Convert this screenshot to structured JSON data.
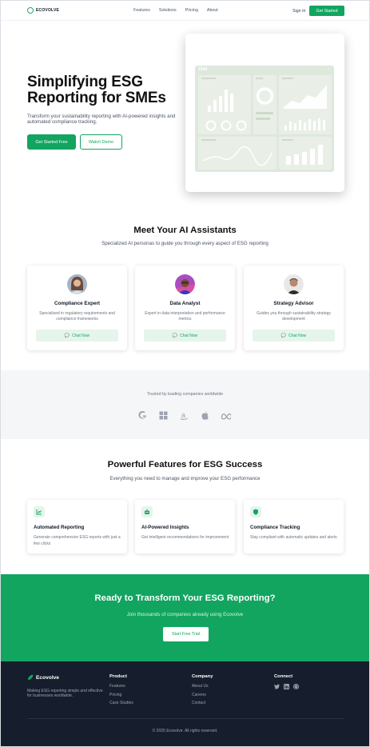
{
  "nav": {
    "logo_text": "ECOVOLVE",
    "links": [
      "Features",
      "Solutions",
      "Pricing",
      "About"
    ],
    "signin_label": "Sign In",
    "get_started_label": "Get Started"
  },
  "hero": {
    "title": "Simplifying ESG Reporting for SMEs",
    "subtitle": "Transform your sustainability reporting with AI-powered insights and automated compliance tracking.",
    "primary_cta": "Get Started Free",
    "secondary_cta": "Watch Demo",
    "dashboard_value": "1540"
  },
  "assistants": {
    "title": "Meet Your AI Assistants",
    "subtitle": "Specialized AI personas to guide you through every aspect of ESG reporting",
    "items": [
      {
        "name": "Compliance Expert",
        "desc": "Specialized in regulatory requirements and compliance frameworks",
        "cta": "Chat Now"
      },
      {
        "name": "Data Analyst",
        "desc": "Expert in data interpretation and performance metrics",
        "cta": "Chat Now"
      },
      {
        "name": "Strategy Advisor",
        "desc": "Guides you through sustainability strategy development",
        "cta": "Chat Now"
      }
    ]
  },
  "trusted": {
    "title": "Trusted by leading companies worldwide",
    "brands": [
      "google-logo-icon",
      "windows-logo-icon",
      "amazon-logo-icon",
      "apple-logo-icon",
      "meta-logo-icon"
    ]
  },
  "features": {
    "title": "Powerful Features for ESG Success",
    "subtitle": "Everything you need to manage and improve your ESG performance",
    "items": [
      {
        "title": "Automated Reporting",
        "desc": "Generate comprehensive ESG reports with just a few clicks",
        "icon": "chart-icon"
      },
      {
        "title": "AI-Powered Insights",
        "desc": "Get intelligent recommendations for improvement",
        "icon": "robot-icon"
      },
      {
        "title": "Compliance Tracking",
        "desc": "Stay compliant with automatic updates and alerts",
        "icon": "shield-icon"
      }
    ]
  },
  "cta": {
    "title": "Ready to Transform Your ESG Reporting?",
    "subtitle": "Join thousands of companies already using Ecovolve",
    "button": "Start Free Trial"
  },
  "footer": {
    "logo_text": "Ecovolve",
    "tagline": "Making ESG reporting simple and effective for businesses worldwide.",
    "columns": [
      {
        "title": "Product",
        "links": [
          "Features",
          "Pricing",
          "Case Studies"
        ]
      },
      {
        "title": "Company",
        "links": [
          "About Us",
          "Careers",
          "Contact"
        ]
      },
      {
        "title": "Connect",
        "socials": [
          "twitter-icon",
          "linkedin-icon",
          "github-icon"
        ]
      }
    ],
    "copyright": "© 2025 Ecovolve. All rights reserved."
  },
  "colors": {
    "brand_green": "#12a560",
    "footer_bg": "#161d2c",
    "trusted_bg": "#f5f6f8"
  }
}
